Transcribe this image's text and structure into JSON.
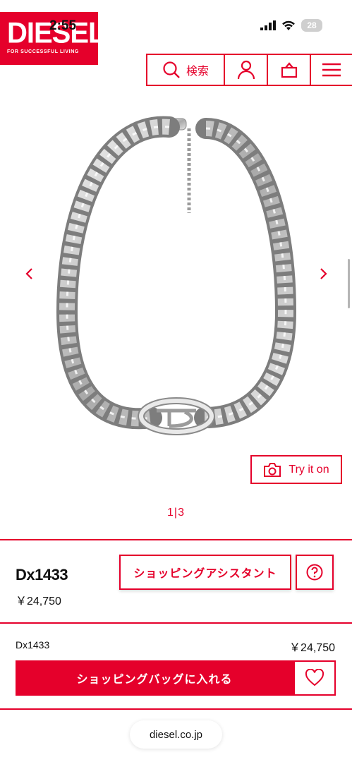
{
  "status_bar": {
    "time": "2:55",
    "battery": "28"
  },
  "brand": {
    "name": "DIESEL",
    "tagline": "FOR SUCCESSFUL LIVING",
    "accent": "#e5002b"
  },
  "header": {
    "search_label": "検索",
    "icons": [
      "search-icon",
      "account-icon",
      "shopping-bag-icon",
      "menu-icon"
    ]
  },
  "gallery": {
    "pager": "1|3",
    "try_on_label": "Try it on",
    "icons": [
      "chevron-left-icon",
      "chevron-right-icon",
      "camera-icon"
    ]
  },
  "product": {
    "name": "Dx1433",
    "price": "￥24,750",
    "assistant_label": "ショッピングアシスタント",
    "sku": "Dx1433",
    "sku_price": "￥24,750",
    "add_to_bag_label": "ショッピングバッグに入れる"
  },
  "browser": {
    "url": "diesel.co.jp"
  }
}
